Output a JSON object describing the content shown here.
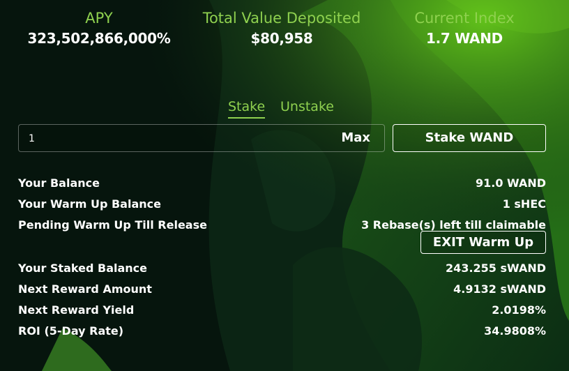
{
  "stats": {
    "apy": {
      "label": "APY",
      "value": "323,502,866,000%"
    },
    "tvd": {
      "label": "Total Value Deposited",
      "value": "$80,958"
    },
    "index": {
      "label": "Current Index",
      "value": "1.7 WAND"
    }
  },
  "tabs": [
    {
      "label": "Stake",
      "active": true
    },
    {
      "label": "Unstake",
      "active": false
    }
  ],
  "amount_input": {
    "value": "1",
    "placeholder": ""
  },
  "max_label": "Max",
  "stake_button_label": "Stake WAND",
  "balances": {
    "your_balance": {
      "label": "Your Balance",
      "value": "91.0 WAND"
    },
    "warm_up_balance": {
      "label": "Your Warm Up Balance",
      "value": "1 sHEC"
    },
    "pending_warm_up": {
      "label": "Pending Warm Up Till Release",
      "value": "3 Rebase(s) left till claimable"
    },
    "exit_warm_up_label": "EXIT Warm Up",
    "staked_balance": {
      "label": "Your Staked Balance",
      "value": "243.255 sWAND"
    },
    "next_reward_amount": {
      "label": "Next Reward Amount",
      "value": "4.9132 sWAND"
    },
    "next_reward_yield": {
      "label": "Next Reward Yield",
      "value": "2.0198%"
    },
    "roi_5day": {
      "label": "ROI (5-Day Rate)",
      "value": "34.9808%"
    }
  },
  "colors": {
    "accent": "#8fd14f",
    "background": "#06150d",
    "text": "#ffffff"
  }
}
